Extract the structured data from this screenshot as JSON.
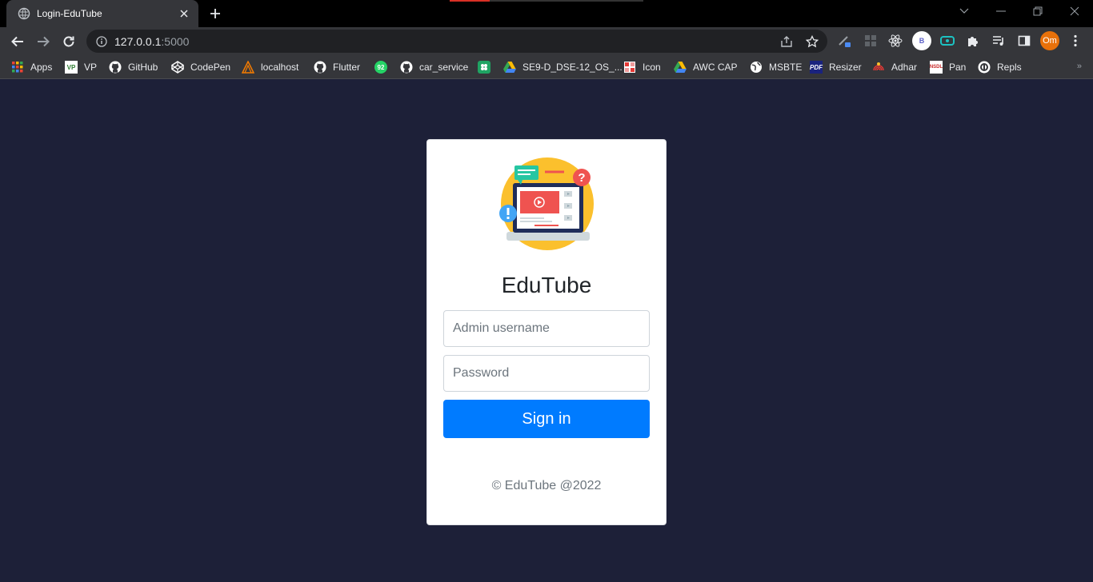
{
  "browser": {
    "tab": {
      "title": "Login-EduTube"
    },
    "address": {
      "host": "127.0.0.1",
      "port": ":5000"
    },
    "profile_initials": "Om",
    "ext_letter": "B",
    "bookmarks": [
      {
        "label": "Apps",
        "icon": "apps-grid-icon"
      },
      {
        "label": "VP",
        "icon": "vp-favicon-icon",
        "badge": "VP"
      },
      {
        "label": "GitHub",
        "icon": "github-icon"
      },
      {
        "label": "CodePen",
        "icon": "codepen-icon"
      },
      {
        "label": "localhost",
        "icon": "localhost-icon"
      },
      {
        "label": "Flutter",
        "icon": "github-icon"
      },
      {
        "label": "",
        "icon": "whatsapp-icon",
        "badge": "92"
      },
      {
        "label": "car_service",
        "icon": "github-icon"
      },
      {
        "label": "",
        "icon": "green-app-icon"
      },
      {
        "label": "SE9-D_DSE-12_OS_...",
        "icon": "google-drive-icon"
      },
      {
        "label": "Icon",
        "icon": "icon-grid-icon"
      },
      {
        "label": "AWC CAP",
        "icon": "google-drive-icon"
      },
      {
        "label": "MSBTE",
        "icon": "globe-icon"
      },
      {
        "label": "Resizer",
        "icon": "pdf-resizer-icon",
        "badge": "PDF"
      },
      {
        "label": "Adhar",
        "icon": "aadhaar-icon"
      },
      {
        "label": "Pan",
        "icon": "nsdl-icon",
        "badge": "NSDL"
      },
      {
        "label": "Repls",
        "icon": "replit-icon"
      }
    ],
    "more_bookmarks": "»"
  },
  "login": {
    "brand": "EduTube",
    "username_placeholder": "Admin username",
    "password_placeholder": "Password",
    "signin_label": "Sign in",
    "footer": "© EduTube @2022"
  },
  "colors": {
    "page_background": "#1d2038",
    "primary_button": "#007bff",
    "logo_circle": "#fbc02d"
  }
}
